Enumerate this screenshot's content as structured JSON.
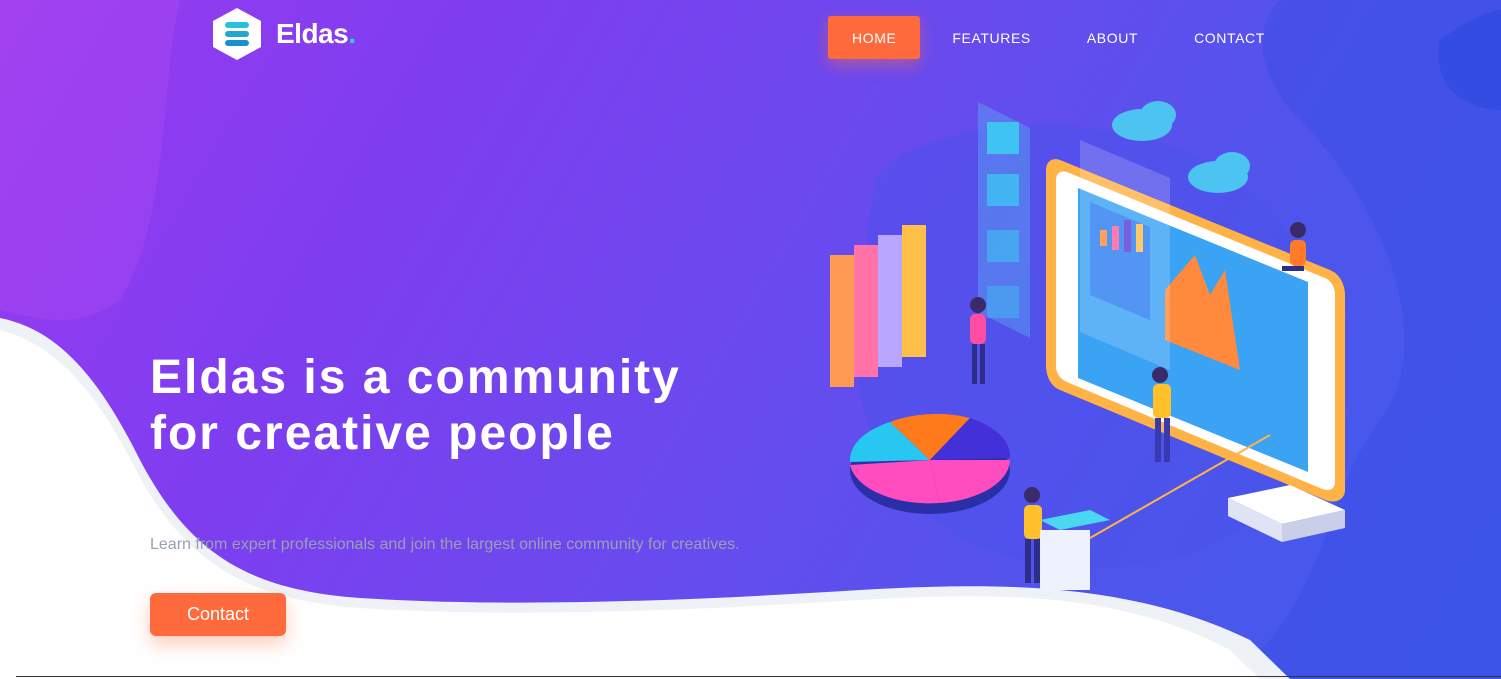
{
  "brand": {
    "name": "Eldas",
    "dot": "."
  },
  "nav": {
    "items": [
      {
        "label": "HOME",
        "active": true
      },
      {
        "label": "FEATURES",
        "active": false
      },
      {
        "label": "ABOUT",
        "active": false
      },
      {
        "label": "CONTACT",
        "active": false
      }
    ]
  },
  "hero": {
    "headline": "Eldas is a community for creative people",
    "subtext": "Learn from expert professionals and join the largest online community for creatives.",
    "cta_label": "Contact"
  },
  "colors": {
    "accent": "#ff6a3d",
    "gradient_start": "#9a3cf0",
    "gradient_end": "#3f5cec",
    "logo_dot": "#21d6c6"
  }
}
